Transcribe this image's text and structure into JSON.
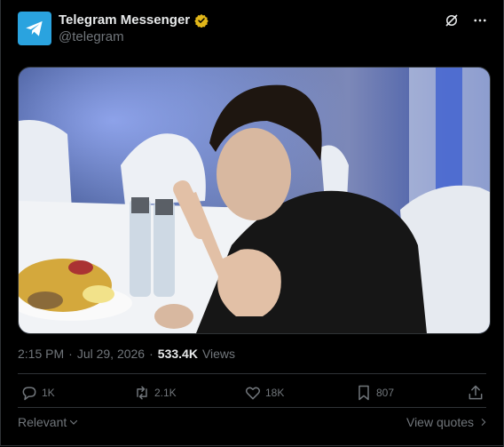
{
  "author": {
    "name": "Telegram Messenger",
    "handle": "@telegram",
    "verified": true
  },
  "icons": {
    "avatar": "telegram-paper-plane-icon",
    "verified": "verified-badge-icon",
    "grok": "grok-icon",
    "more": "more-options-icon",
    "reply": "reply-icon",
    "repost": "repost-icon",
    "like": "like-icon",
    "bookmark": "bookmark-icon",
    "share": "share-icon"
  },
  "post": {
    "time": "2:15 PM",
    "separator": "·",
    "date": "Jul 29, 2026",
    "views_count": "533.4K",
    "views_label": "Views"
  },
  "actions": {
    "replies": "1K",
    "reposts": "2.1K",
    "likes": "18K",
    "bookmarks": "807"
  },
  "footer": {
    "sort_label": "Relevant",
    "quotes_label": "View quotes"
  },
  "colors": {
    "background": "#000000",
    "text": "#e7e9ea",
    "muted": "#71767b",
    "border": "#2f3336",
    "verified": "#e2b719",
    "telegram_blue": "#2aa3df"
  }
}
